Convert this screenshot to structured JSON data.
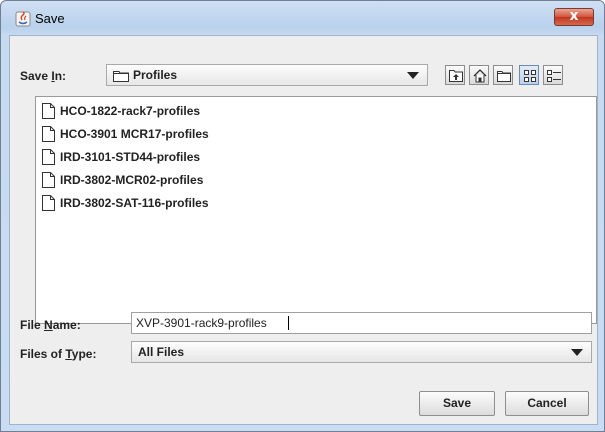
{
  "window": {
    "title": "Save",
    "close_label": "x"
  },
  "save_in": {
    "label_pre": "Save ",
    "label_mnemonic": "I",
    "label_post": "n:",
    "selected": "Profiles"
  },
  "toolbar": {
    "buttons": [
      {
        "name": "up-one-level-icon"
      },
      {
        "name": "home-icon"
      },
      {
        "name": "new-folder-icon"
      },
      {
        "name": "list-view-icon"
      },
      {
        "name": "details-view-icon"
      }
    ]
  },
  "files": [
    {
      "name": "HCO-1822-rack7-profiles"
    },
    {
      "name": "HCO-3901 MCR17-profiles"
    },
    {
      "name": "IRD-3101-STD44-profiles"
    },
    {
      "name": "IRD-3802-MCR02-profiles"
    },
    {
      "name": "IRD-3802-SAT-116-profiles"
    }
  ],
  "file_name": {
    "label_pre": "File ",
    "label_mnemonic": "N",
    "label_post": "ame:",
    "value": "XVP-3901-rack9-profiles"
  },
  "files_of_type": {
    "label_pre": "Files of ",
    "label_mnemonic": "T",
    "label_post": "ype:",
    "selected": "All Files"
  },
  "buttons": {
    "save": "Save",
    "cancel": "Cancel"
  },
  "colors": {
    "title_gradient_top": "#cfe0f3",
    "close_button": "#c2361f",
    "content_bg": "#eeeeee"
  }
}
